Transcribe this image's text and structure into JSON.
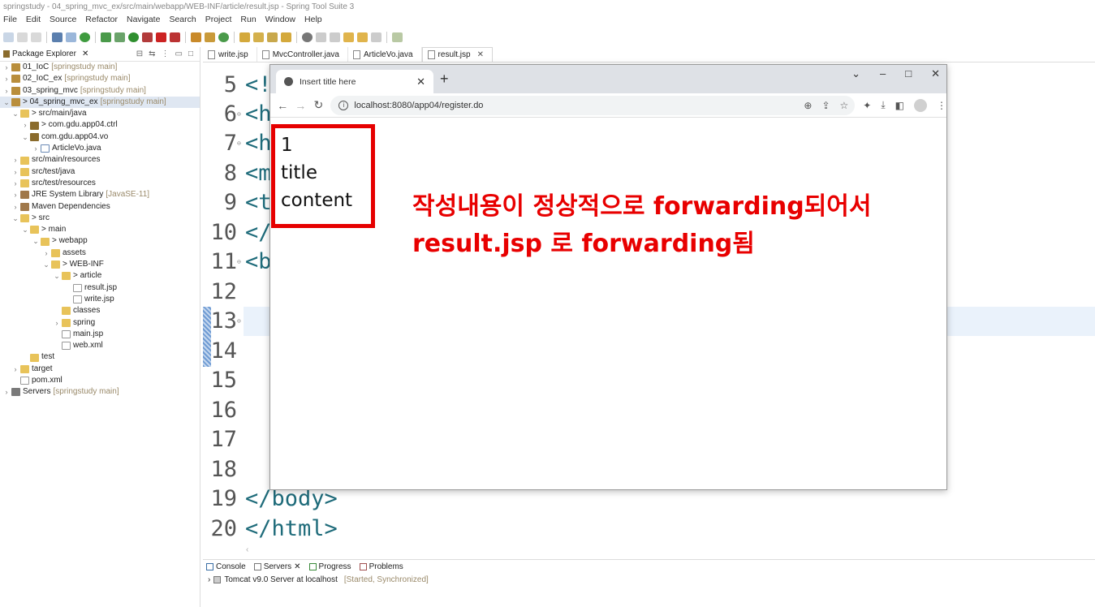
{
  "window": {
    "title": "springstudy - 04_spring_mvc_ex/src/main/webapp/WEB-INF/article/result.jsp - Spring Tool Suite 3"
  },
  "menu": [
    "File",
    "Edit",
    "Source",
    "Refactor",
    "Navigate",
    "Search",
    "Project",
    "Run",
    "Window",
    "Help"
  ],
  "package_explorer": {
    "title": "Package Explorer",
    "items": [
      {
        "label": "01_IoC",
        "note": "[springstudy main]"
      },
      {
        "label": "02_IoC_ex",
        "note": "[springstudy main]"
      },
      {
        "label": "03_spring_mvc",
        "note": "[springstudy main]"
      },
      {
        "label": "> 04_spring_mvc_ex",
        "note": "[springstudy main]"
      },
      {
        "label": "> src/main/java"
      },
      {
        "label": "> com.gdu.app04.ctrl"
      },
      {
        "label": "com.gdu.app04.vo"
      },
      {
        "label": "ArticleVo.java"
      },
      {
        "label": "src/main/resources"
      },
      {
        "label": "src/test/java"
      },
      {
        "label": "src/test/resources"
      },
      {
        "label": "JRE System Library",
        "note": "[JavaSE-11]"
      },
      {
        "label": "Maven Dependencies"
      },
      {
        "label": "> src"
      },
      {
        "label": "> main"
      },
      {
        "label": "> webapp"
      },
      {
        "label": "assets"
      },
      {
        "label": "> WEB-INF"
      },
      {
        "label": "> article"
      },
      {
        "label": "result.jsp"
      },
      {
        "label": "write.jsp"
      },
      {
        "label": "classes"
      },
      {
        "label": "spring"
      },
      {
        "label": "main.jsp"
      },
      {
        "label": "web.xml"
      },
      {
        "label": "test"
      },
      {
        "label": "target"
      },
      {
        "label": "pom.xml"
      },
      {
        "label": "Servers",
        "note": "[springstudy main]"
      }
    ]
  },
  "editor_tabs": [
    "write.jsp",
    "MvcController.java",
    "ArticleVo.java",
    "result.jsp"
  ],
  "code_lines": [
    {
      "num": "5",
      "text": "<!"
    },
    {
      "num": "6",
      "text": "<h"
    },
    {
      "num": "7",
      "text": "<h"
    },
    {
      "num": "8",
      "text": "<m"
    },
    {
      "num": "9",
      "text": "<t"
    },
    {
      "num": "10",
      "text": "</"
    },
    {
      "num": "11",
      "text": "<b"
    },
    {
      "num": "12",
      "text": ""
    },
    {
      "num": "13",
      "text": ""
    },
    {
      "num": "14",
      "text": ""
    },
    {
      "num": "15",
      "text": ""
    },
    {
      "num": "16",
      "text": ""
    },
    {
      "num": "17",
      "text": ""
    },
    {
      "num": "18",
      "text": ""
    },
    {
      "num": "19",
      "text": "</body>"
    },
    {
      "num": "20",
      "text": "</html>"
    }
  ],
  "bottom_panel": {
    "tabs": [
      "Console",
      "Servers",
      "Progress",
      "Problems"
    ],
    "server": "Tomcat v9.0 Server at localhost",
    "server_state": "[Started, Synchronized]"
  },
  "browser": {
    "tab_title": "Insert title here",
    "url": "localhost:8080/app04/register.do",
    "output_lines": [
      "1",
      "title",
      "content"
    ]
  },
  "annotation": {
    "line1": "작성내용이 정상적으로 forwarding되어서",
    "line2": "result.jsp 로 forwarding됨"
  },
  "colors": {
    "annotation": "#e80000",
    "box": "#e60000",
    "tag": "#1e6b7a"
  }
}
